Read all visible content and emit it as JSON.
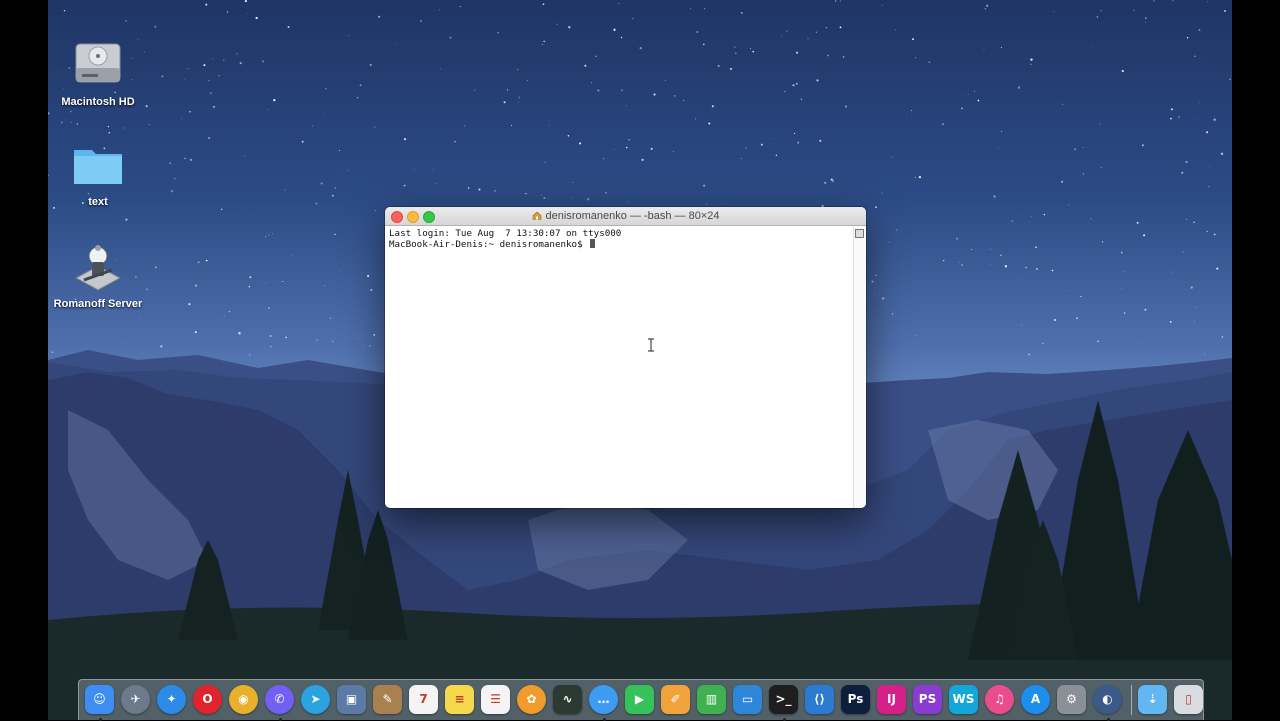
{
  "desktop": {
    "icons": [
      {
        "label": "Macintosh HD",
        "icon": "hard-drive-icon"
      },
      {
        "label": "text",
        "icon": "folder-icon"
      },
      {
        "label": "Romanoff Server",
        "icon": "server-app-icon"
      }
    ]
  },
  "terminal": {
    "title": "denisromanenko — -bash — 80×24",
    "lines": [
      "Last login: Tue Aug  7 13:30:07 on ttys000",
      "MacBook-Air-Denis:~ denisromanenko$ "
    ]
  },
  "dock": {
    "apps": [
      {
        "name": "Finder",
        "icon": "finder-icon",
        "color": "#3d8ef0",
        "running": true
      },
      {
        "name": "Launchpad",
        "icon": "launchpad-icon",
        "color": "#6d7a8c",
        "running": false
      },
      {
        "name": "Safari",
        "icon": "safari-icon",
        "color": "#2c8ae8",
        "running": false
      },
      {
        "name": "Opera",
        "icon": "opera-icon",
        "color": "#e0232c",
        "running": false
      },
      {
        "name": "Chrome",
        "icon": "chrome-icon",
        "color": "#e9b12b",
        "running": false
      },
      {
        "name": "Viber",
        "icon": "viber-icon",
        "color": "#7360f2",
        "running": true
      },
      {
        "name": "Telegram",
        "icon": "telegram-icon",
        "color": "#2aa3de",
        "running": false
      },
      {
        "name": "Preview",
        "icon": "preview-icon",
        "color": "#5c7aa6",
        "running": false
      },
      {
        "name": "Notefile",
        "icon": "notebook-icon",
        "color": "#a98050",
        "running": false
      },
      {
        "name": "Calendar",
        "icon": "calendar-icon",
        "color": "#f4f4f4",
        "running": false
      },
      {
        "name": "Notes",
        "icon": "notes-icon",
        "color": "#f5d84b",
        "running": false
      },
      {
        "name": "Reminders",
        "icon": "reminders-icon",
        "color": "#f4f4f4",
        "running": false
      },
      {
        "name": "Photos",
        "icon": "photos-icon",
        "color": "#f09b2c",
        "running": false
      },
      {
        "name": "Activity Monitor",
        "icon": "activity-monitor-icon",
        "color": "#2b3a33",
        "running": false
      },
      {
        "name": "Messages",
        "icon": "messages-icon",
        "color": "#3d9cf2",
        "running": true
      },
      {
        "name": "FaceTime",
        "icon": "facetime-icon",
        "color": "#35c25a",
        "running": false
      },
      {
        "name": "Pages",
        "icon": "pages-icon",
        "color": "#f0a23b",
        "running": false
      },
      {
        "name": "Numbers",
        "icon": "numbers-icon",
        "color": "#3fb24f",
        "running": false
      },
      {
        "name": "Keynote",
        "icon": "keynote-icon",
        "color": "#2f86d9",
        "running": false
      },
      {
        "name": "Terminal",
        "icon": "terminal-icon",
        "color": "#1e1e1e",
        "running": true
      },
      {
        "name": "VS Code",
        "icon": "vscode-icon",
        "color": "#2b7bd1",
        "running": false
      },
      {
        "name": "Photoshop",
        "icon": "photoshop-icon",
        "color": "#0d1f3a",
        "running": false
      },
      {
        "name": "IntelliJ IDEA",
        "icon": "intellij-icon",
        "color": "#d5208a",
        "running": false
      },
      {
        "name": "PhpStorm",
        "icon": "phpstorm-icon",
        "color": "#8a3cd1",
        "running": false
      },
      {
        "name": "WebStorm",
        "icon": "webstorm-icon",
        "color": "#12a7d8",
        "running": false
      },
      {
        "name": "iTunes",
        "icon": "itunes-icon",
        "color": "#e94d8c",
        "running": false
      },
      {
        "name": "App Store",
        "icon": "app-store-icon",
        "color": "#1c8ef0",
        "running": false
      },
      {
        "name": "System Preferences",
        "icon": "system-preferences-icon",
        "color": "#8b8f96",
        "running": false
      },
      {
        "name": "Sierra",
        "icon": "macos-installer-icon",
        "color": "#3b5a8a",
        "running": true
      }
    ],
    "trailing": [
      {
        "name": "Downloads",
        "icon": "downloads-folder-icon",
        "color": "#62b6f2"
      },
      {
        "name": "Trash",
        "icon": "trash-icon",
        "color": "#d9dde2"
      }
    ]
  }
}
